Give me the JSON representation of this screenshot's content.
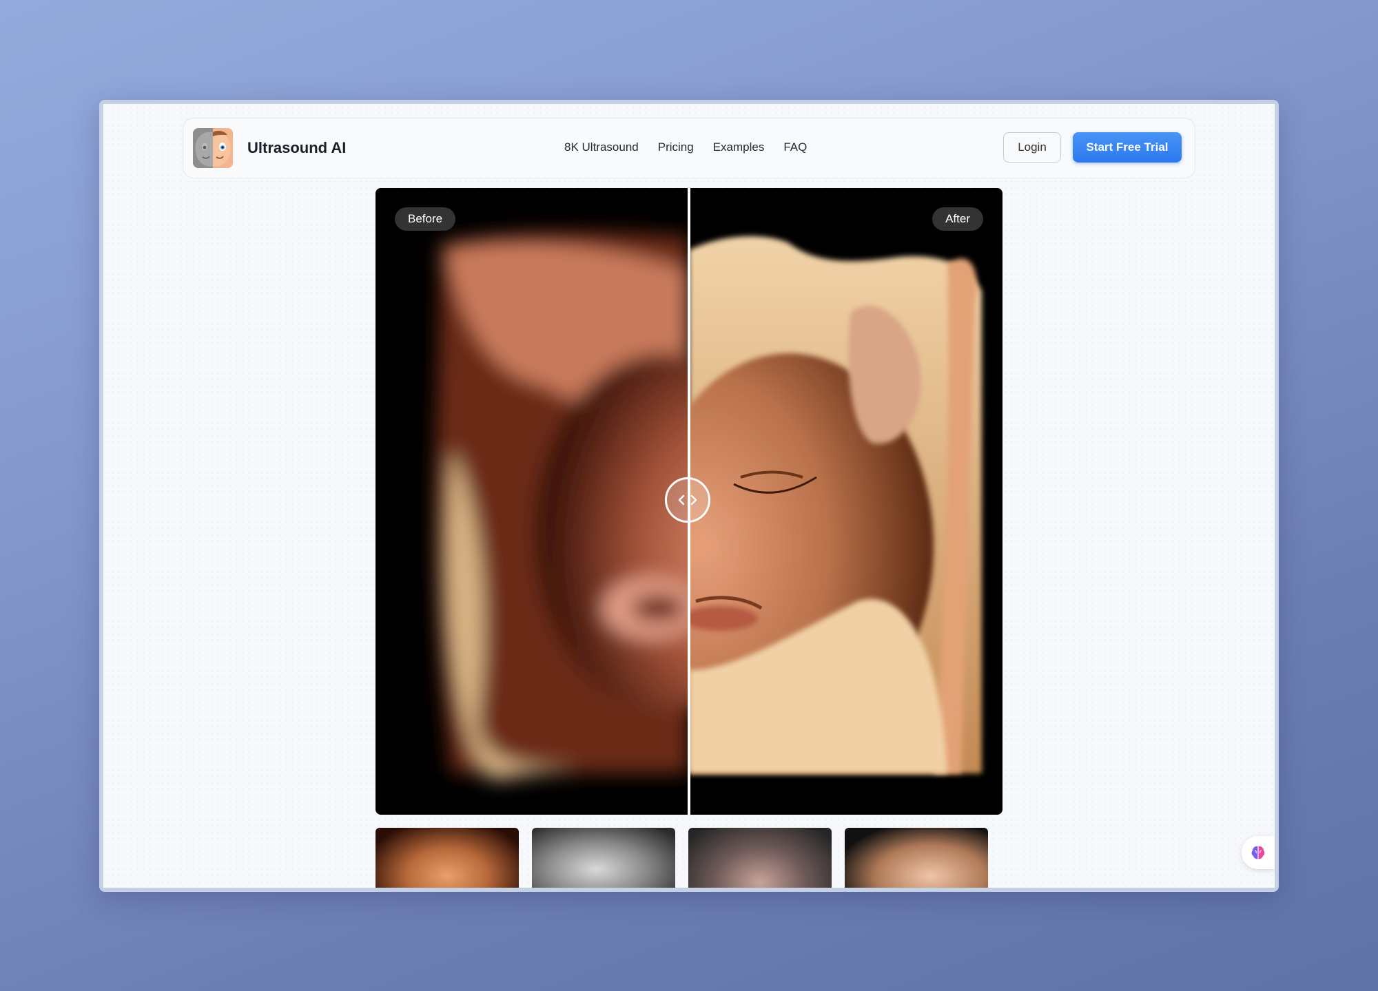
{
  "navbar": {
    "brand": "Ultrasound AI",
    "links": [
      "8K Ultrasound",
      "Pricing",
      "Examples",
      "FAQ"
    ],
    "login_label": "Login",
    "trial_label": "Start Free Trial"
  },
  "comparison": {
    "before_label": "Before",
    "after_label": "After",
    "slider_position": 0.5
  },
  "thumbnails": [
    "baby ultrasound photo 1",
    "grayscale ultrasound 2",
    "grayscale ultrasound 3",
    "baby ultrasound photo 4"
  ],
  "icons": {
    "logo": "cartoon-baby-face-icon",
    "handle": "chevron-left-right-icon",
    "floating": "brain-icon"
  },
  "colors": {
    "accent": "#2f7cf0",
    "background": "#f6f8fb"
  }
}
